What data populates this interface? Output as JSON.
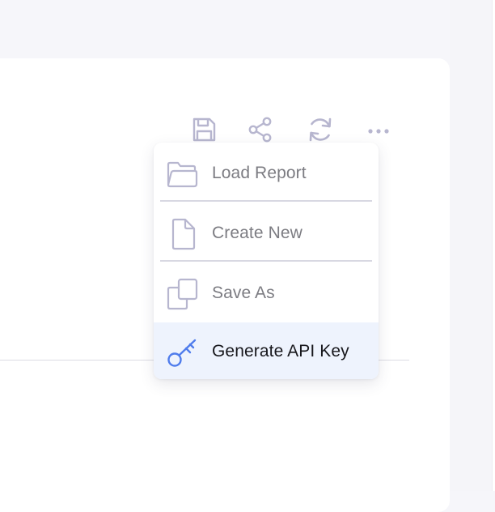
{
  "toolbar": {
    "icons": [
      {
        "icon": "save-icon",
        "label": ""
      },
      {
        "icon": "share-icon",
        "label": ""
      },
      {
        "icon": "refresh-icon",
        "label": ""
      },
      {
        "icon": "more-horizontal-icon",
        "label": ""
      }
    ]
  },
  "menu": {
    "items": [
      {
        "label": "Load Report",
        "icon": "folder-icon",
        "active": false
      },
      {
        "label": "Create New",
        "icon": "file-icon",
        "active": false
      },
      {
        "label": "Save As",
        "icon": "copy-icon",
        "active": false
      },
      {
        "label": "Generate API Key",
        "icon": "key-icon",
        "active": true
      }
    ]
  },
  "colors": {
    "icon_muted": "#b7b6cf",
    "icon_accent": "#4f7cec",
    "active_bg": "#eef3fd",
    "text_muted": "#7c7c82",
    "text_active": "#17171c"
  }
}
